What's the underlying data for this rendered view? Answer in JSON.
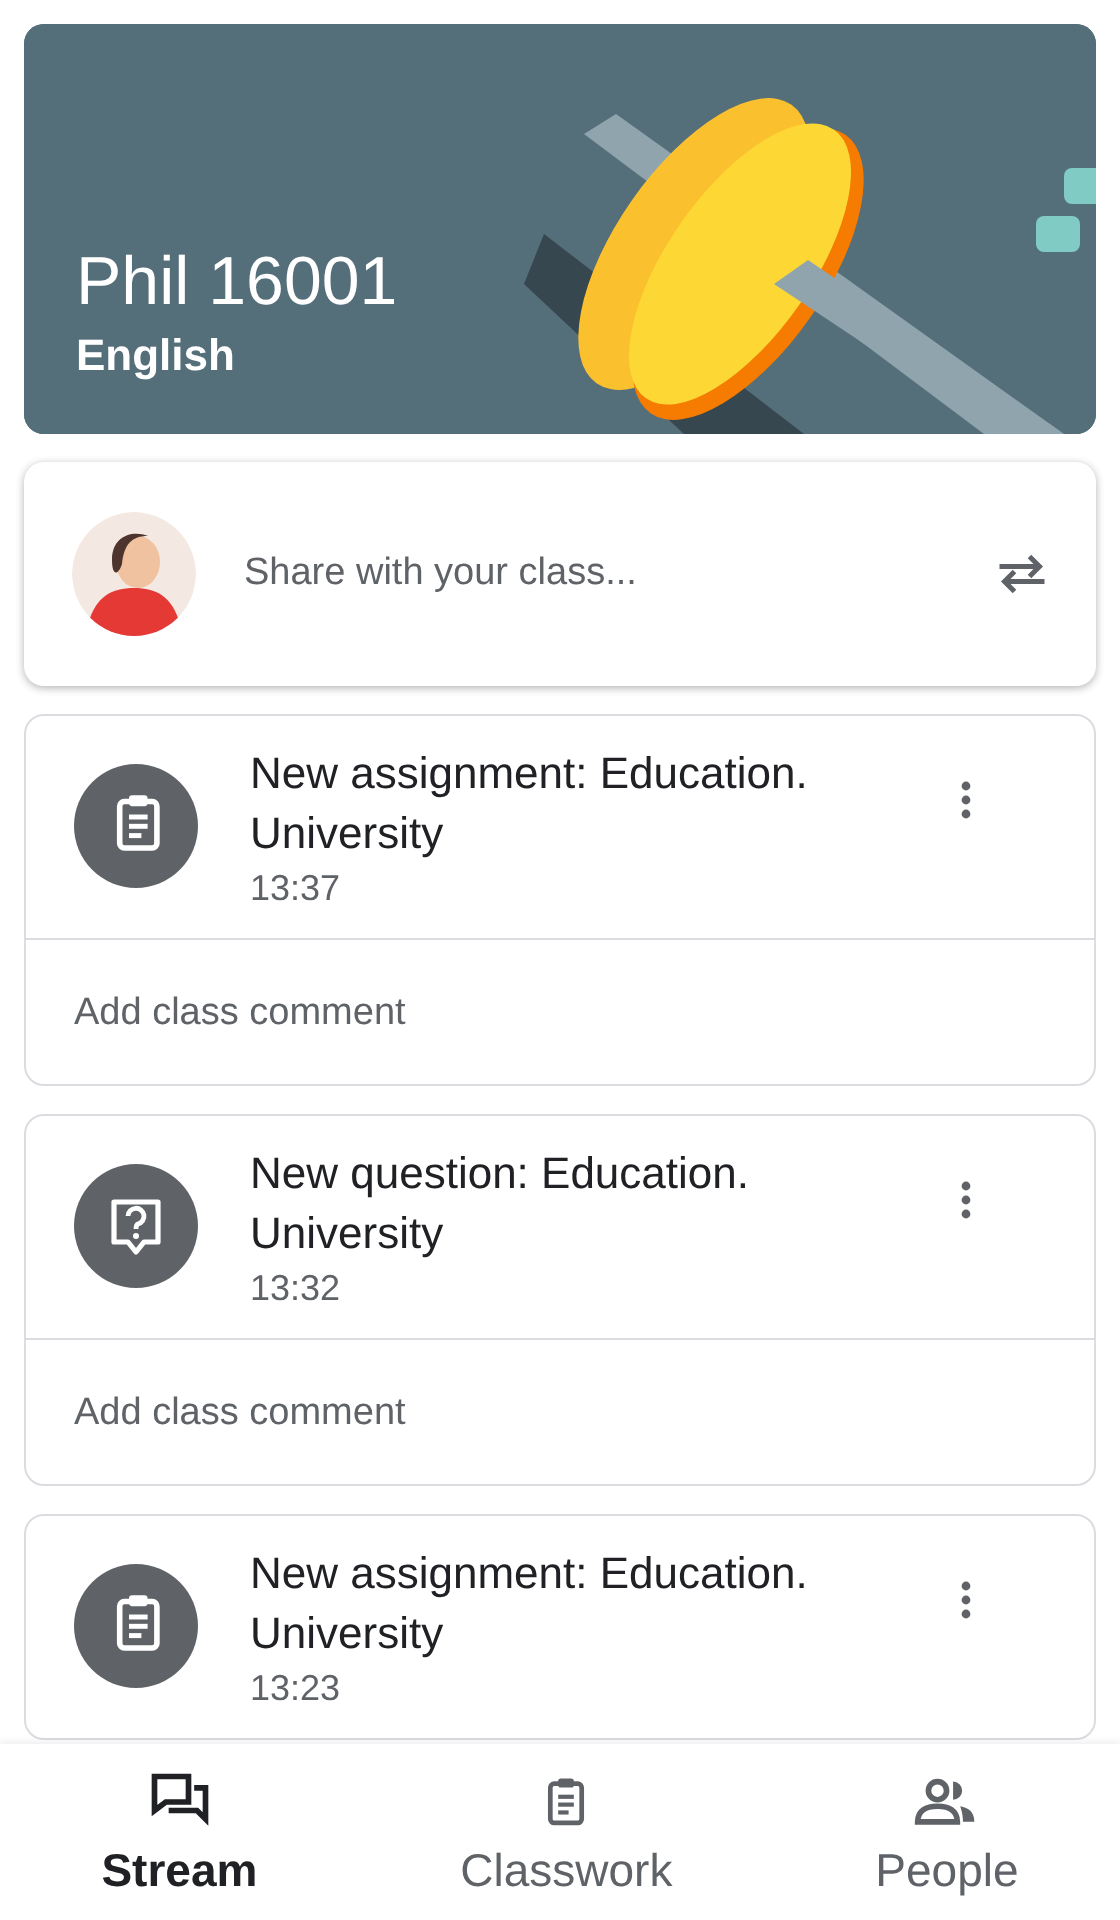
{
  "banner": {
    "title": "Phil 16001",
    "subtitle": "English"
  },
  "share": {
    "placeholder": "Share with your class..."
  },
  "posts": [
    {
      "kind": "assignment",
      "title": "New assignment: Education. University",
      "time": "13:37",
      "comment_placeholder": "Add class comment"
    },
    {
      "kind": "question",
      "title": "New question: Education. University",
      "time": "13:32",
      "comment_placeholder": "Add class comment"
    },
    {
      "kind": "assignment",
      "title": "New assignment: Education. University",
      "time": "13:23"
    }
  ],
  "nav": [
    {
      "label": "Stream",
      "kind": "stream",
      "selected": true
    },
    {
      "label": "Classwork",
      "kind": "classwork",
      "selected": false
    },
    {
      "label": "People",
      "kind": "people",
      "selected": false
    }
  ]
}
